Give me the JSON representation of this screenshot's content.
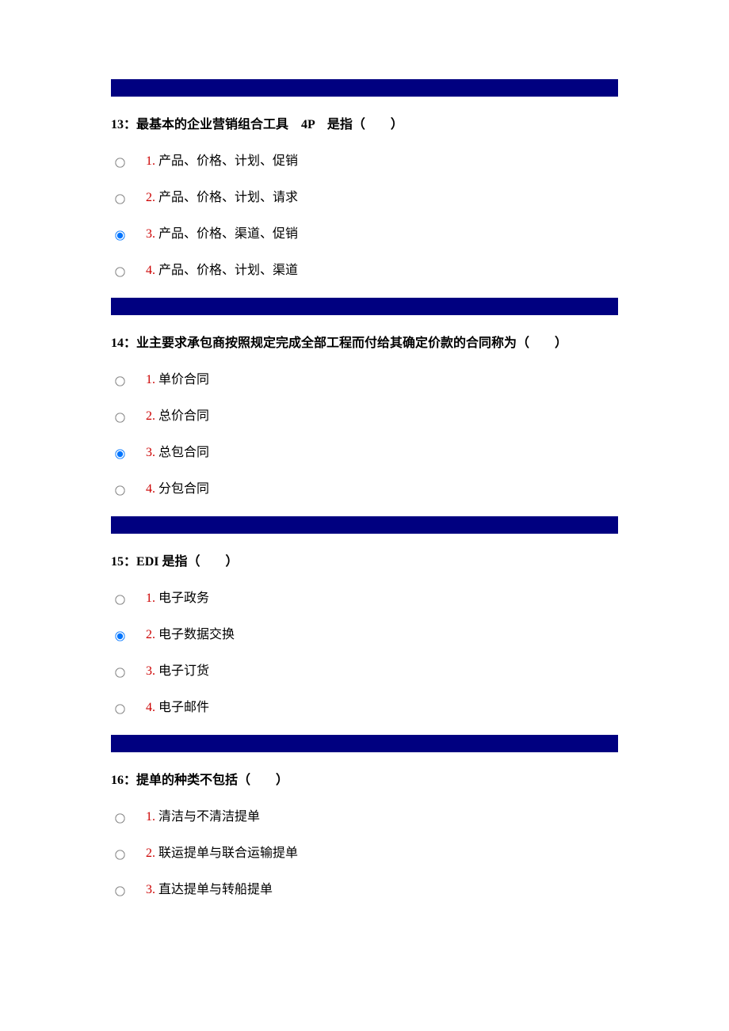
{
  "theme": {
    "bar_color": "#000080",
    "number_color": "#CC0000"
  },
  "questions": [
    {
      "number": "13",
      "text": "最基本的企业营销组合工具　4P　是指（　　）",
      "selected_index": 2,
      "options": [
        {
          "num": "1.",
          "text": "产品、价格、计划、促销"
        },
        {
          "num": "2.",
          "text": "产品、价格、计划、请求"
        },
        {
          "num": "3.",
          "text": "产品、价格、渠道、促销"
        },
        {
          "num": "4.",
          "text": "产品、价格、计划、渠道"
        }
      ]
    },
    {
      "number": "14",
      "text": "业主要求承包商按照规定完成全部工程而付给其确定价款的合同称为（　　）",
      "selected_index": 2,
      "options": [
        {
          "num": "1.",
          "text": "单价合同"
        },
        {
          "num": "2.",
          "text": "总价合同"
        },
        {
          "num": "3.",
          "text": "总包合同"
        },
        {
          "num": "4.",
          "text": "分包合同"
        }
      ]
    },
    {
      "number": "15",
      "text": "EDI 是指（　　）",
      "selected_index": 1,
      "options": [
        {
          "num": "1.",
          "text": "电子政务"
        },
        {
          "num": "2.",
          "text": "电子数据交换"
        },
        {
          "num": "3.",
          "text": "电子订货"
        },
        {
          "num": "4.",
          "text": "电子邮件"
        }
      ]
    },
    {
      "number": "16",
      "text": "提单的种类不包括（　　）",
      "selected_index": -1,
      "options": [
        {
          "num": "1.",
          "text": "清洁与不清洁提单"
        },
        {
          "num": "2.",
          "text": "联运提单与联合运输提单"
        },
        {
          "num": "3.",
          "text": "直达提单与转船提单"
        }
      ]
    }
  ]
}
